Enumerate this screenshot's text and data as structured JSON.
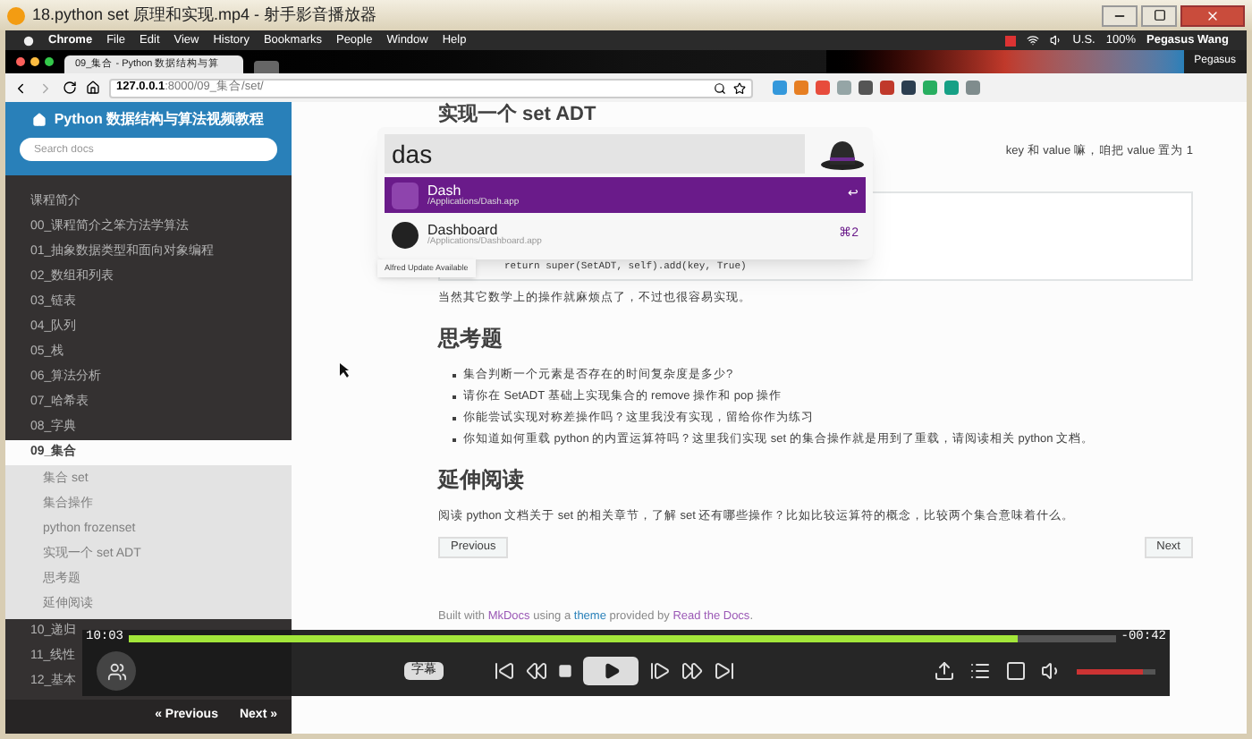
{
  "window": {
    "title": "18.python set 原理和实现.mp4 - 射手影音播放器"
  },
  "menubar": {
    "items": [
      "Chrome",
      "File",
      "Edit",
      "View",
      "History",
      "Bookmarks",
      "People",
      "Window",
      "Help"
    ],
    "keyboard": "U.S.",
    "battery": "100%",
    "user": "Pegasus Wang"
  },
  "browser": {
    "tab": "09_集合 - Python 数据结构与算",
    "profile": "Pegasus",
    "url_host": "127.0.0.1",
    "url_path": ":8000/09_集合/set/"
  },
  "sidebar": {
    "title": "Python 数据结构与算法视频教程",
    "search": {
      "placeholder": "Search docs"
    },
    "items": [
      {
        "label": "课程简介",
        "selected": false
      },
      {
        "label": "00_课程简介之笨方法学算法",
        "selected": false
      },
      {
        "label": "01_抽象数据类型和面向对象编程",
        "selected": false
      },
      {
        "label": "02_数组和列表",
        "selected": false
      },
      {
        "label": "03_链表",
        "selected": false
      },
      {
        "label": "04_队列",
        "selected": false
      },
      {
        "label": "05_栈",
        "selected": false
      },
      {
        "label": "06_算法分析",
        "selected": false
      },
      {
        "label": "07_哈希表",
        "selected": false
      },
      {
        "label": "08_字典",
        "selected": false
      },
      {
        "label": "09_集合",
        "selected": true,
        "children": [
          {
            "label": "集合 set"
          },
          {
            "label": "集合操作"
          },
          {
            "label": "python frozenset"
          },
          {
            "label": "实现一个 set ADT"
          },
          {
            "label": "思考题"
          },
          {
            "label": "延伸阅读"
          }
        ]
      },
      {
        "label": "10_递归",
        "selected": false
      },
      {
        "label": "11_线性",
        "selected": false
      },
      {
        "label": "12_基本",
        "selected": false
      }
    ],
    "prev": "« Previous",
    "next": "Next »"
  },
  "content": {
    "heading": "实现一个 set ADT",
    "side_text": "key 和 value 嘛，咱把 value 置为 1",
    "code": "return super(SetADT, self).add(key, True)",
    "after_code": "当然其它数学上的操作就麻烦点了，不过也很容易实现。",
    "section1": "思考题",
    "bullets": [
      "集合判断一个元素是否存在的时间复杂度是多少?",
      "请你在 SetADT 基础上实现集合的 remove 操作和 pop 操作",
      "你能尝试实现对称差操作吗？这里我没有实现，留给你作为练习",
      "你知道如何重载 python 的内置运算符吗？这里我们实现 set 的集合操作就是用到了重载，请阅读相关 python 文档。"
    ],
    "section2": "延伸阅读",
    "para": "阅读 python 文档关于 set 的相关章节，了解 set 还有哪些操作？比如比较运算符的概念，比较两个集合意味着什么。",
    "prev": "Previous",
    "next": "Next",
    "footer": {
      "a": "Built with ",
      "mkdocs": "MkDocs",
      "b": " using a ",
      "theme": "theme",
      "c": " provided by ",
      "rtd": "Read the Docs",
      "d": "."
    }
  },
  "launcher": {
    "query": "das",
    "results": [
      {
        "name": "Dash",
        "path": "/Applications/Dash.app",
        "hint": "↩",
        "selected": true
      },
      {
        "name": "Dashboard",
        "path": "/Applications/Dashboard.app",
        "hint": "⌘2",
        "selected": false
      }
    ],
    "notice": "Alfred Update Available"
  },
  "player": {
    "elapsed": "10:03",
    "remaining": "-00:42",
    "level": 0.9,
    "subtitle": "字幕",
    "volume": {
      "level": 0.85
    }
  }
}
